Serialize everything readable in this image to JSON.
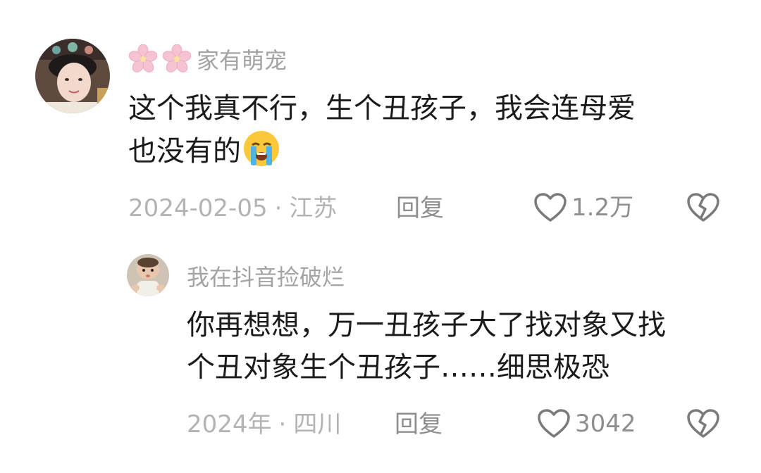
{
  "comment": {
    "username": "家有萌宠",
    "text_lines": [
      "这个我真不行，生个丑孩子，我会连母爱",
      "也没有的"
    ],
    "emoji_icon": "loudly-crying-face",
    "date": "2024-02-05",
    "separator": "·",
    "location": "江苏",
    "reply_label": "回复",
    "like_count": "1.2万"
  },
  "reply": {
    "username": "我在抖音捡破烂",
    "text_lines": [
      "你再想想，万一丑孩子大了找对象又找",
      "个丑对象生个丑孩子……细思极恐"
    ],
    "date": "2024年",
    "separator": "·",
    "location": "四川",
    "reply_label": "回复",
    "like_count": "3042"
  },
  "icons": {
    "username_prefix": "cherry-blossom-icon",
    "like": "heart-outline-icon",
    "dislike": "broken-heart-icon"
  },
  "colors": {
    "username": "#a3a3a3",
    "text": "#1b1b1b",
    "meta": "#b3b3b3",
    "action": "#8e8e8e",
    "blossom": "#f6c3d2"
  }
}
